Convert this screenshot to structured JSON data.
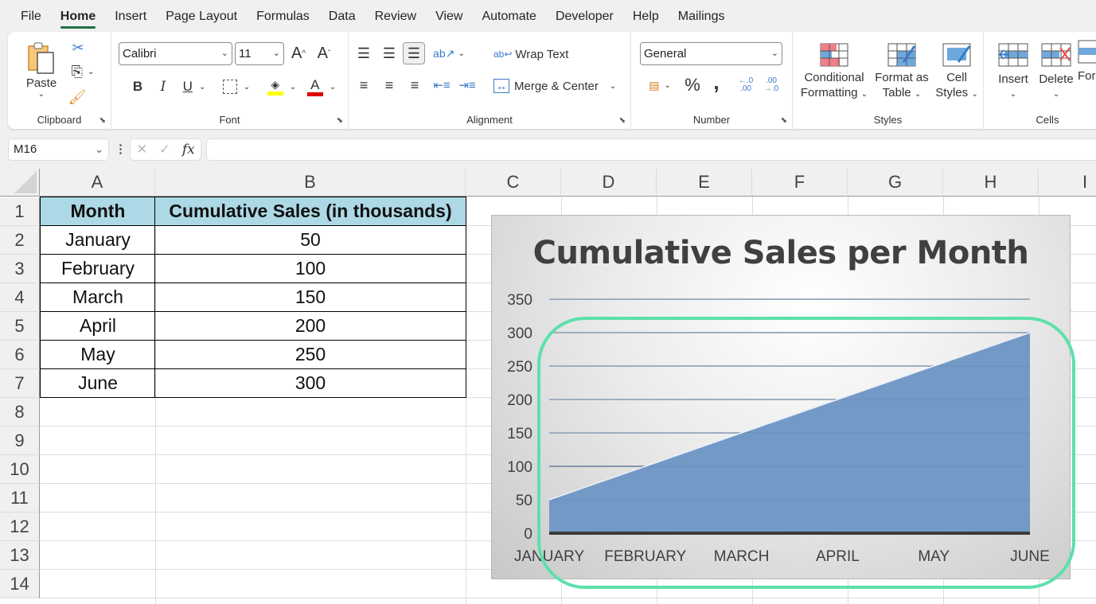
{
  "menu": {
    "tabs": [
      "File",
      "Home",
      "Insert",
      "Page Layout",
      "Formulas",
      "Data",
      "Review",
      "View",
      "Automate",
      "Developer",
      "Help",
      "Mailings"
    ],
    "active": "Home"
  },
  "ribbon": {
    "clipboard": {
      "paste_label": "Paste",
      "group_label": "Clipboard"
    },
    "font": {
      "font_name": "Calibri",
      "font_size": "11",
      "bold": "B",
      "italic": "I",
      "underline": "U",
      "grow": "A",
      "shrink": "A",
      "group_label": "Font",
      "highlight_color": "#ffff00",
      "font_color": "#e00000"
    },
    "alignment": {
      "wrap_text": "Wrap Text",
      "merge_center": "Merge & Center",
      "group_label": "Alignment"
    },
    "number": {
      "format": "General",
      "percent": "%",
      "comma": ",",
      "inc_decimal": "←.0 .00",
      "dec_decimal": ".00 →.0",
      "group_label": "Number"
    },
    "styles": {
      "conditional_line1": "Conditional",
      "conditional_line2": "Formatting",
      "format_table_line1": "Format as",
      "format_table_line2": "Table",
      "cell_styles_line1": "Cell",
      "cell_styles_line2": "Styles",
      "group_label": "Styles"
    },
    "cells": {
      "insert": "Insert",
      "delete": "Delete",
      "format": "For",
      "group_label": "Cells"
    }
  },
  "formula_bar": {
    "name_box": "M16",
    "fx": "fx",
    "value": ""
  },
  "sheet": {
    "columns": [
      "A",
      "B",
      "C",
      "D",
      "E",
      "F",
      "G",
      "H",
      "I"
    ],
    "rows": [
      "1",
      "2",
      "3",
      "4",
      "5",
      "6",
      "7",
      "8",
      "9",
      "10",
      "11",
      "12",
      "13",
      "14"
    ],
    "table": {
      "headers": [
        "Month",
        "Cumulative Sales (in thousands)"
      ],
      "rows": [
        [
          "January",
          "50"
        ],
        [
          "February",
          "100"
        ],
        [
          "March",
          "150"
        ],
        [
          "April",
          "200"
        ],
        [
          "May",
          "250"
        ],
        [
          "June",
          "300"
        ]
      ],
      "header_color": "#add8e6"
    }
  },
  "chart_data": {
    "type": "area",
    "title": "Cumulative Sales per Month",
    "categories": [
      "JANUARY",
      "FEBRUARY",
      "MARCH",
      "APRIL",
      "MAY",
      "JUNE"
    ],
    "series": [
      {
        "name": "Cumulative Sales (in thousands)",
        "values": [
          50,
          100,
          150,
          200,
          250,
          300
        ],
        "color": "#7399c6"
      }
    ],
    "xlabel": "",
    "ylabel": "",
    "ylim": [
      0,
      350
    ],
    "yticks": [
      0,
      50,
      100,
      150,
      200,
      250,
      300,
      350
    ],
    "grid": true,
    "legend": "none"
  },
  "annotation": {
    "color": "#5de0aa"
  }
}
